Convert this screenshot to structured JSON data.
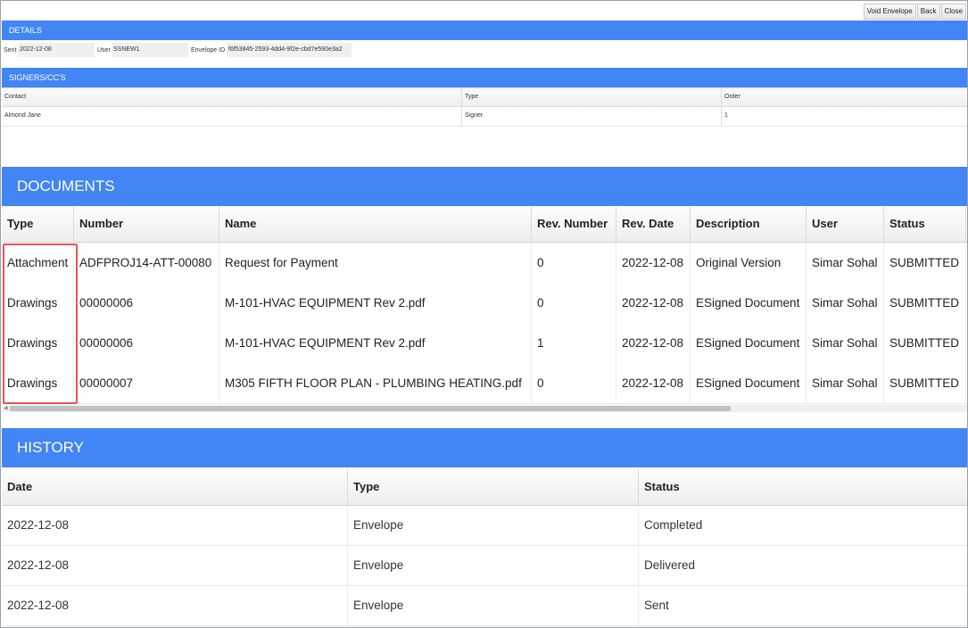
{
  "toolbar": {
    "void_label": "Void Envelope",
    "back_label": "Back",
    "close_label": "Close"
  },
  "details": {
    "title": "DETAILS",
    "sent_label": "Sent",
    "sent_value": "2022-12-08",
    "user_label": "User",
    "user_value": "SSNEW1",
    "envelope_label": "Envelope ID",
    "envelope_value": "f6f53845-2593-4dd4-9f2e-cbd7e590e3a2"
  },
  "signers": {
    "title": "SIGNERS/CC'S",
    "columns": [
      "Contact",
      "Type",
      "Order"
    ],
    "rows": [
      [
        "Almond Jane",
        "Signer",
        "1"
      ]
    ]
  },
  "documents": {
    "title": "DOCUMENTS",
    "columns": [
      "Type",
      "Number",
      "Name",
      "Rev. Number",
      "Rev. Date",
      "Description",
      "User",
      "Status"
    ],
    "rows": [
      [
        "Attachment",
        "ADFPROJ14-ATT-00080",
        "Request for Payment",
        "0",
        "2022-12-08",
        "Original Version",
        "Simar Sohal",
        "SUBMITTED"
      ],
      [
        "Drawings",
        "00000006",
        "M-101-HVAC EQUIPMENT Rev 2.pdf",
        "0",
        "2022-12-08",
        "ESigned Document",
        "Simar Sohal",
        "SUBMITTED"
      ],
      [
        "Drawings",
        "00000006",
        "M-101-HVAC EQUIPMENT Rev 2.pdf",
        "1",
        "2022-12-08",
        "ESigned Document",
        "Simar Sohal",
        "SUBMITTED"
      ],
      [
        "Drawings",
        "00000007",
        "M305 FIFTH FLOOR PLAN - PLUMBING HEATING.pdf",
        "0",
        "2022-12-08",
        "ESigned Document",
        "Simar Sohal",
        "SUBMITTED"
      ]
    ]
  },
  "history": {
    "title": "HISTORY",
    "columns": [
      "Date",
      "Type",
      "Status"
    ],
    "rows": [
      [
        "2022-12-08",
        "Envelope",
        "Completed"
      ],
      [
        "2022-12-08",
        "Envelope",
        "Delivered"
      ],
      [
        "2022-12-08",
        "Envelope",
        "Sent"
      ]
    ]
  },
  "colors": {
    "section_bar": "#4285f4",
    "highlight": "#e05555"
  }
}
